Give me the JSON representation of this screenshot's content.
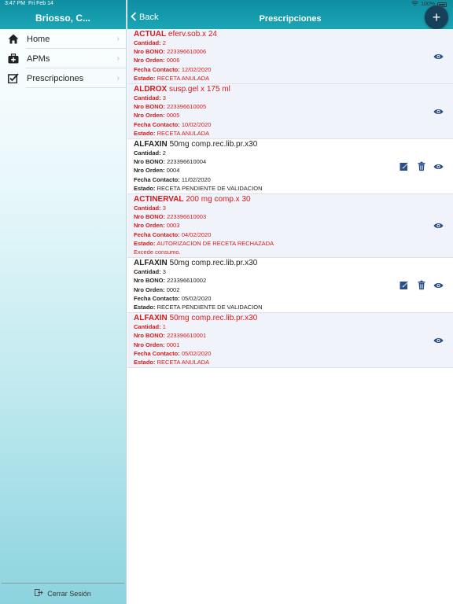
{
  "status": {
    "time": "3:47 PM",
    "date": "Fri Feb 14",
    "battery": "100%"
  },
  "sidebar": {
    "title": "Briosso, C...",
    "items": [
      {
        "label": "Home",
        "icon": "home-icon"
      },
      {
        "label": "APMs",
        "icon": "medical-kit-icon"
      },
      {
        "label": "Prescripciones",
        "icon": "edit-check-icon"
      }
    ],
    "logout_label": "Cerrar Sesión"
  },
  "nav": {
    "back_label": "Back",
    "title": "Prescripciones",
    "add_label": "+"
  },
  "labels": {
    "cantidad": "Cantidad:",
    "bono": "Nro BONO:",
    "orden": "Nro Orden:",
    "fecha": "Fecha Contacto:",
    "estado": "Estado:"
  },
  "colors": {
    "accent": "#1aa6b5",
    "fab": "#17405a",
    "alert_red": "#d61a1a",
    "icon_blue": "#2a4e86"
  },
  "prescriptions": [
    {
      "name": "ACTUAL",
      "detail": "eferv.sob.x 24",
      "cantidad": "2",
      "bono": "223396610006",
      "orden": "0006",
      "fecha": "12/02/2020",
      "estado": "RECETA ANULADA",
      "extra": "",
      "color": "red",
      "editable": false
    },
    {
      "name": "ALDROX",
      "detail": "susp.gel x 175 ml",
      "cantidad": "3",
      "bono": "223396610005",
      "orden": "0005",
      "fecha": "10/02/2020",
      "estado": "RECETA ANULADA",
      "extra": "",
      "color": "red",
      "editable": false
    },
    {
      "name": "ALFAXIN",
      "detail": "50mg comp.rec.lib.pr.x30",
      "cantidad": "2",
      "bono": "223396610004",
      "orden": "0004",
      "fecha": "11/02/2020",
      "estado": "RECETA PENDIENTE DE VALIDACION",
      "extra": "",
      "color": "black",
      "editable": true
    },
    {
      "name": "ACTINERVAL",
      "detail": "200 mg comp.x 30",
      "cantidad": "3",
      "bono": "223396610003",
      "orden": "0003",
      "fecha": "04/02/2020",
      "estado": "AUTORIZACION DE RECETA RECHAZADA",
      "extra": "Excede consumo.",
      "color": "red",
      "editable": false
    },
    {
      "name": "ALFAXIN",
      "detail": "50mg comp.rec.lib.pr.x30",
      "cantidad": "3",
      "bono": "223396610002",
      "orden": "0002",
      "fecha": "05/02/2020",
      "estado": "RECETA PENDIENTE DE VALIDACION",
      "extra": "",
      "color": "black",
      "editable": true
    },
    {
      "name": "ALFAXIN",
      "detail": "50mg comp.rec.lib.pr.x30",
      "cantidad": "1",
      "bono": "223396610001",
      "orden": "0001",
      "fecha": "05/02/2020",
      "estado": "RECETA ANULADA",
      "extra": "",
      "color": "red",
      "editable": false
    }
  ]
}
